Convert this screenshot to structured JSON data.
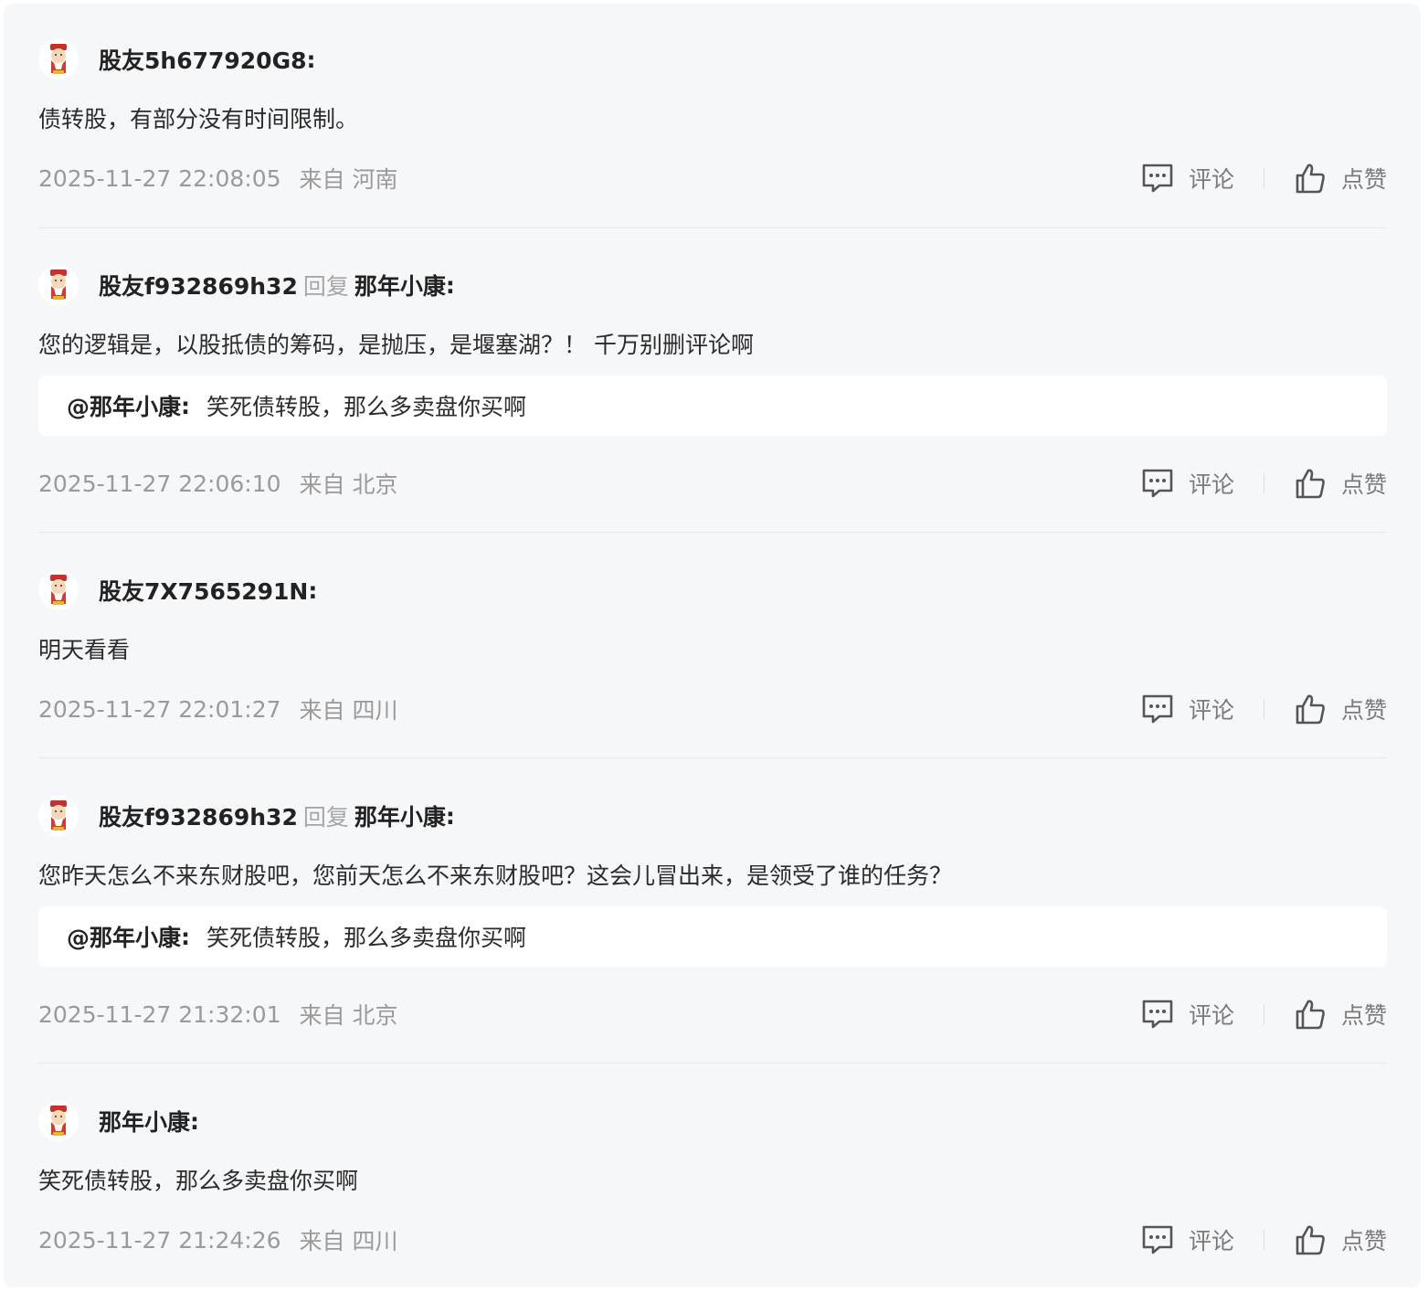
{
  "comments": [
    {
      "user": "股友5h677920G8",
      "reply_word": "",
      "reply_to": "",
      "colon": ":",
      "text": "债转股，有部分没有时间限制。",
      "quote_user": "",
      "quote_text": "",
      "time": "2025-11-27 22:08:05",
      "location": "来自 河南"
    },
    {
      "user": "股友f932869h32",
      "reply_word": "回复",
      "reply_to": "那年小康",
      "colon": ":",
      "text": "您的逻辑是，以股抵债的筹码，是抛压，是堰塞湖？！ 千万别删评论啊",
      "quote_user": "@那年小康",
      "quote_text": "笑死债转股，那么多卖盘你买啊",
      "time": "2025-11-27 22:06:10",
      "location": "来自 北京"
    },
    {
      "user": "股友7X7565291N",
      "reply_word": "",
      "reply_to": "",
      "colon": ":",
      "text": "明天看看",
      "quote_user": "",
      "quote_text": "",
      "time": "2025-11-27 22:01:27",
      "location": "来自 四川"
    },
    {
      "user": "股友f932869h32",
      "reply_word": "回复",
      "reply_to": "那年小康",
      "colon": ":",
      "text": "您昨天怎么不来东财股吧，您前天怎么不来东财股吧？这会儿冒出来，是领受了谁的任务？",
      "quote_user": "@那年小康",
      "quote_text": "笑死债转股，那么多卖盘你买啊",
      "time": "2025-11-27 21:32:01",
      "location": "来自 北京"
    },
    {
      "user": "那年小康",
      "reply_word": "",
      "reply_to": "",
      "colon": ":",
      "text": "笑死债转股，那么多卖盘你买啊",
      "quote_user": "",
      "quote_text": "",
      "time": "2025-11-27 21:24:26",
      "location": "来自 四川"
    }
  ],
  "quote_colon": ":",
  "actions": {
    "comment_label": "评论",
    "like_label": "点赞",
    "comment_icon": "comment-bubble-icon",
    "like_icon": "thumbs-up-icon"
  },
  "colors": {
    "panel_bg": "#f6f7f9",
    "username": "#222222",
    "meta_text": "#9a9a9a",
    "action_text": "#7a7a7a"
  }
}
